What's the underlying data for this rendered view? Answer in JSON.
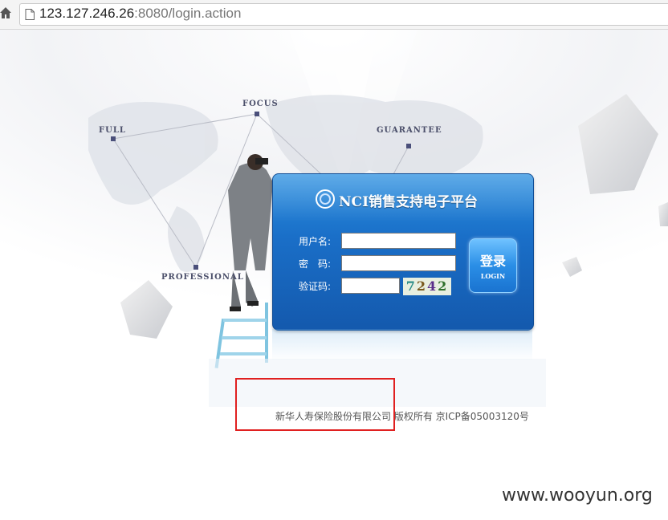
{
  "browser": {
    "url_host": "123.127.246.26",
    "url_rest": ":8080/login.action"
  },
  "map_labels": {
    "full": "FULL",
    "focus": "FOCUS",
    "guarantee": "GUARANTEE",
    "professional": "PROFESSIONAL"
  },
  "login": {
    "title": "NCI销售支持电子平台",
    "username_label": "用户名:",
    "password_label": "密　码:",
    "captcha_label": "验证码:",
    "username_value": "",
    "password_value": "",
    "captcha_value": "",
    "captcha_chars": [
      "7",
      "2",
      "4",
      "2"
    ],
    "button_cn": "登录",
    "button_en": "LOGIN"
  },
  "footer": {
    "text": "新华人寿保险股份有限公司 版权所有 京ICP备05003120号"
  },
  "watermark": "www.wooyun.org",
  "colors": {
    "panel_blue": "#1a6fc8",
    "highlight_red": "#e02020"
  }
}
